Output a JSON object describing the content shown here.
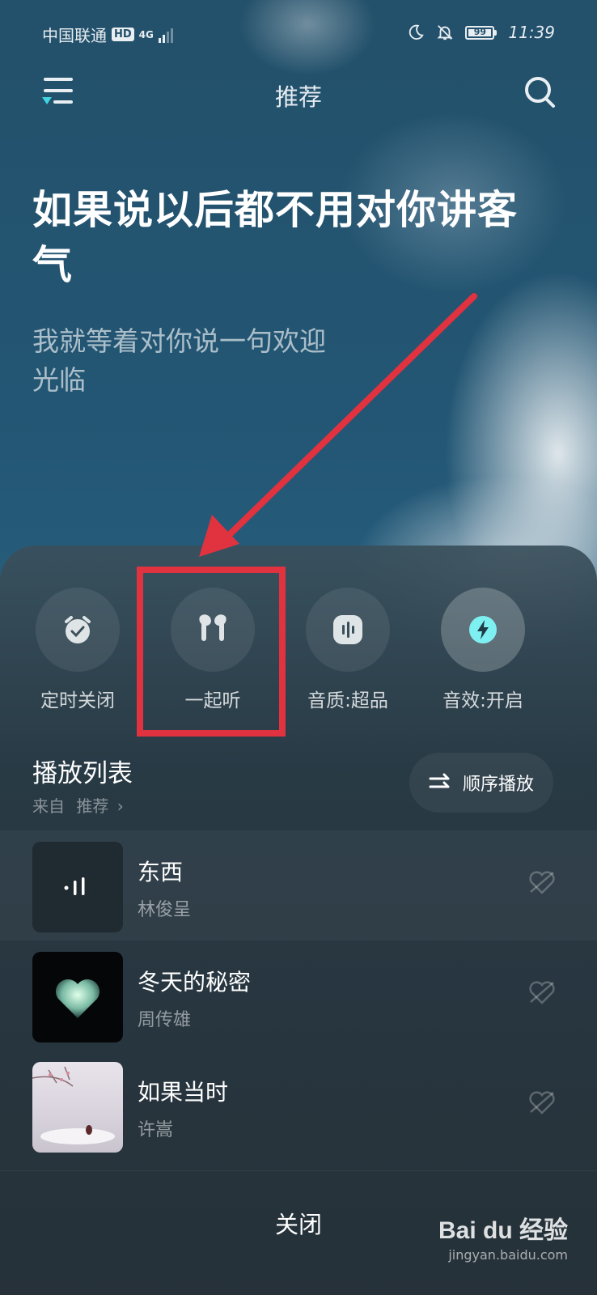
{
  "status_bar": {
    "carrier": "中国联通",
    "hd_badge": "HD",
    "network": "4G",
    "battery_level": "99",
    "time": "11:39"
  },
  "header": {
    "title": "推荐"
  },
  "hero": {
    "lyric_main": "如果说以后都不用对你讲客气",
    "lyric_sub": "我就等着对你说一句欢迎光临"
  },
  "quick_actions": [
    {
      "label": "定时关闭",
      "icon": "alarm-clock-icon"
    },
    {
      "label": "一起听",
      "icon": "earbuds-icon"
    },
    {
      "label": "音质:超品",
      "icon": "audio-quality-icon"
    },
    {
      "label": "音效:开启",
      "icon": "sound-effect-icon"
    }
  ],
  "playlist": {
    "title": "播放列表",
    "from_prefix": "来自",
    "from_source": "推荐",
    "order_label": "顺序播放",
    "songs": [
      {
        "title": "东西",
        "artist": "林俊呈"
      },
      {
        "title": "冬天的秘密",
        "artist": "周传雄"
      },
      {
        "title": "如果当时",
        "artist": "许嵩"
      }
    ]
  },
  "footer": {
    "close_label": "关闭"
  },
  "watermark": {
    "main": "Bai du 经验",
    "sub": "jingyan.baidu.com"
  },
  "colors": {
    "accent": "#3fd6e0",
    "annotation_red": "#e0323f",
    "sky": "#23506a"
  }
}
